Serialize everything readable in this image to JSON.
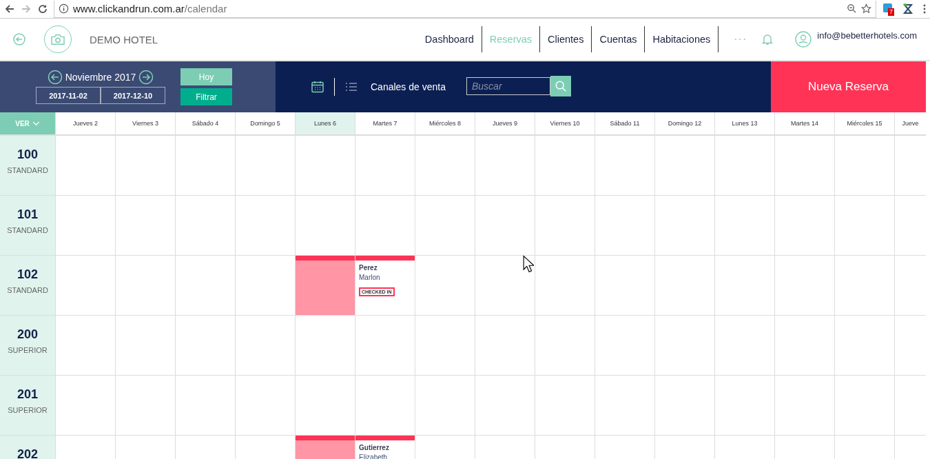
{
  "browser": {
    "url_host": "www.clickandrun.com.ar",
    "url_path": "/calendar",
    "extension_badge": "7"
  },
  "header": {
    "hotel_name": "DEMO HOTEL",
    "nav": [
      {
        "label": "Dashboard",
        "selected": false
      },
      {
        "label": "Reservas",
        "selected": true
      },
      {
        "label": "Clientes",
        "selected": false
      },
      {
        "label": "Cuentas",
        "selected": false
      },
      {
        "label": "Habitaciones",
        "selected": false
      }
    ],
    "more": "···",
    "user_email": "info@bebetterhotels.com"
  },
  "toolbar": {
    "month": "Noviembre 2017",
    "date_from": "2017-11-02",
    "date_to": "2017-12-10",
    "today_button": "Hoy",
    "filter_button": "Filtrar",
    "sales_channels": "Canales de venta",
    "search": {
      "placeholder": "Buscar"
    },
    "new_booking_button": "Nueva Reserva"
  },
  "calendar": {
    "view_button": "VER",
    "days": [
      {
        "label": "Jueves 2",
        "selected": false
      },
      {
        "label": "Viernes 3",
        "selected": false
      },
      {
        "label": "Sábado 4",
        "selected": false
      },
      {
        "label": "Domingo 5",
        "selected": false
      },
      {
        "label": "Lunes 6",
        "selected": true
      },
      {
        "label": "Martes 7",
        "selected": false
      },
      {
        "label": "Miércoles 8",
        "selected": false
      },
      {
        "label": "Jueves 9",
        "selected": false
      },
      {
        "label": "Viernes 10",
        "selected": false
      },
      {
        "label": "Sábado 11",
        "selected": false
      },
      {
        "label": "Domingo 12",
        "selected": false
      },
      {
        "label": "Lunes 13",
        "selected": false
      },
      {
        "label": "Martes 14",
        "selected": false
      },
      {
        "label": "Miércoles 15",
        "selected": false
      },
      {
        "label": "Jueve",
        "selected": false
      }
    ],
    "rooms": [
      {
        "number": "100",
        "type": "STANDARD",
        "cells": [
          {
            "kind": "empty"
          },
          {
            "kind": "empty"
          },
          {
            "kind": "empty"
          },
          {
            "kind": "empty"
          },
          {
            "kind": "empty"
          },
          {
            "kind": "empty"
          },
          {
            "kind": "empty"
          },
          {
            "kind": "empty"
          },
          {
            "kind": "empty"
          },
          {
            "kind": "empty"
          },
          {
            "kind": "empty"
          },
          {
            "kind": "empty"
          },
          {
            "kind": "empty"
          },
          {
            "kind": "empty"
          },
          {
            "kind": "empty"
          }
        ]
      },
      {
        "number": "101",
        "type": "STANDARD",
        "cells": [
          {
            "kind": "empty"
          },
          {
            "kind": "empty"
          },
          {
            "kind": "empty"
          },
          {
            "kind": "empty"
          },
          {
            "kind": "empty"
          },
          {
            "kind": "empty"
          },
          {
            "kind": "empty"
          },
          {
            "kind": "empty"
          },
          {
            "kind": "empty"
          },
          {
            "kind": "empty"
          },
          {
            "kind": "empty"
          },
          {
            "kind": "empty"
          },
          {
            "kind": "empty"
          },
          {
            "kind": "empty"
          },
          {
            "kind": "empty"
          }
        ]
      },
      {
        "number": "102",
        "type": "STANDARD",
        "cells": [
          {
            "kind": "empty"
          },
          {
            "kind": "empty"
          },
          {
            "kind": "empty"
          },
          {
            "kind": "empty"
          },
          {
            "kind": "stay-past"
          },
          {
            "kind": "stay",
            "last_name": "Perez",
            "first_name": "Marlon",
            "status": "CHECKED IN"
          },
          {
            "kind": "empty"
          },
          {
            "kind": "empty"
          },
          {
            "kind": "empty"
          },
          {
            "kind": "empty"
          },
          {
            "kind": "empty"
          },
          {
            "kind": "empty"
          },
          {
            "kind": "empty"
          },
          {
            "kind": "empty"
          },
          {
            "kind": "empty"
          }
        ]
      },
      {
        "number": "200",
        "type": "SUPERIOR",
        "cells": [
          {
            "kind": "empty"
          },
          {
            "kind": "empty"
          },
          {
            "kind": "empty"
          },
          {
            "kind": "empty"
          },
          {
            "kind": "empty"
          },
          {
            "kind": "empty"
          },
          {
            "kind": "empty"
          },
          {
            "kind": "empty"
          },
          {
            "kind": "empty"
          },
          {
            "kind": "empty"
          },
          {
            "kind": "empty"
          },
          {
            "kind": "empty"
          },
          {
            "kind": "empty"
          },
          {
            "kind": "empty"
          },
          {
            "kind": "empty"
          }
        ]
      },
      {
        "number": "201",
        "type": "SUPERIOR",
        "cells": [
          {
            "kind": "empty"
          },
          {
            "kind": "empty"
          },
          {
            "kind": "empty"
          },
          {
            "kind": "empty"
          },
          {
            "kind": "empty"
          },
          {
            "kind": "empty"
          },
          {
            "kind": "empty"
          },
          {
            "kind": "empty"
          },
          {
            "kind": "empty"
          },
          {
            "kind": "empty"
          },
          {
            "kind": "empty"
          },
          {
            "kind": "empty"
          },
          {
            "kind": "empty"
          },
          {
            "kind": "empty"
          },
          {
            "kind": "empty"
          }
        ]
      },
      {
        "number": "202",
        "cells": [
          {
            "kind": "empty"
          },
          {
            "kind": "empty"
          },
          {
            "kind": "empty"
          },
          {
            "kind": "empty"
          },
          {
            "kind": "stay-past"
          },
          {
            "kind": "stay",
            "last_name": "Gutierrez",
            "first_name": "Elizabeth"
          },
          {
            "kind": "empty"
          },
          {
            "kind": "empty"
          },
          {
            "kind": "empty"
          },
          {
            "kind": "empty"
          },
          {
            "kind": "empty"
          },
          {
            "kind": "empty"
          },
          {
            "kind": "empty"
          },
          {
            "kind": "empty"
          },
          {
            "kind": "empty"
          }
        ]
      }
    ]
  }
}
